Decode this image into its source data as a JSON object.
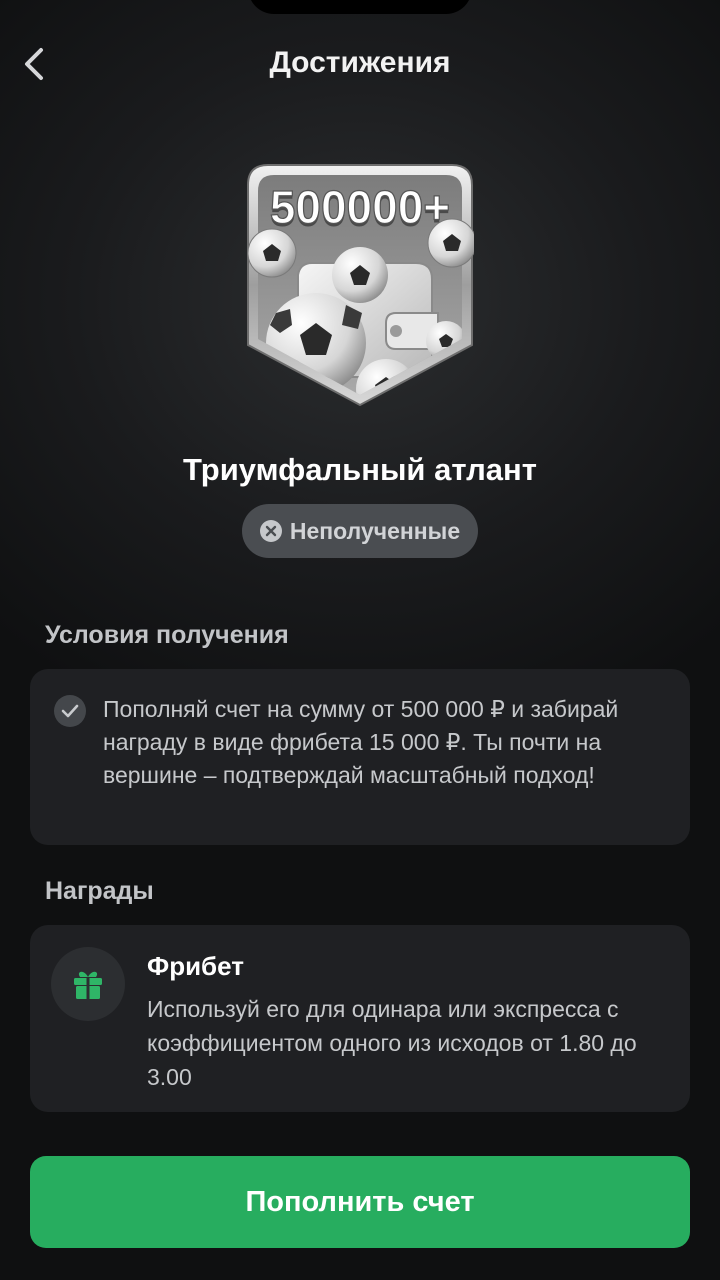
{
  "header": {
    "title": "Достижения",
    "back_icon": "chevron-left-icon"
  },
  "achievement": {
    "badge_label": "500000+",
    "badge_art": "wallet-with-soccer-balls",
    "title": "Триумфальный атлант",
    "status": {
      "label": "Неполученные",
      "icon": "close-circle-icon"
    }
  },
  "conditions": {
    "section_title": "Условия получения",
    "icon": "check-circle-icon",
    "text": "Пополняй счет на сумму от 500 000 ₽ и забирай награду в виде фрибета 15 000 ₽. Ты почти на вершине – подтверждай масштабный подход!"
  },
  "rewards": {
    "section_title": "Награды",
    "items": [
      {
        "icon": "gift-icon",
        "name": "Фрибет",
        "description": "Используй его для одинара или экспресса с коэффициентом одного из исходов от 1.80 до 3.00"
      }
    ]
  },
  "cta": {
    "label": "Пополнить счет"
  },
  "colors": {
    "accent": "#27ad5f",
    "background": "#151618",
    "card": "#1f2023",
    "pill": "#4a4d51"
  }
}
